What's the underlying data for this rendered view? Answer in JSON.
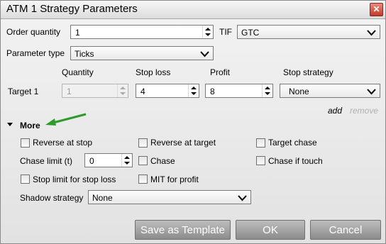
{
  "title": "ATM 1 Strategy Parameters",
  "close_label": "✕",
  "order_quantity": {
    "label": "Order quantity",
    "value": "1"
  },
  "tif": {
    "label": "TIF",
    "value": "GTC"
  },
  "parameter_type": {
    "label": "Parameter type",
    "value": "Ticks"
  },
  "columns": {
    "quantity": "Quantity",
    "stop_loss": "Stop loss",
    "profit": "Profit",
    "stop_strategy": "Stop strategy"
  },
  "target1": {
    "label": "Target 1",
    "quantity": "1",
    "stop_loss": "4",
    "profit": "8",
    "stop_strategy": "None"
  },
  "links": {
    "add": "add",
    "remove": "remove"
  },
  "more": {
    "label": "More"
  },
  "options": {
    "reverse_at_stop": "Reverse at stop",
    "reverse_at_target": "Reverse at target",
    "target_chase": "Target chase",
    "chase_limit_label": "Chase limit (t)",
    "chase_limit_value": "0",
    "chase": "Chase",
    "chase_if_touch": "Chase if touch",
    "stop_limit_for_stop_loss": "Stop limit for stop loss",
    "mit_for_profit": "MIT for profit"
  },
  "shadow_strategy": {
    "label": "Shadow strategy",
    "value": "None"
  },
  "buttons": {
    "save_template": "Save as Template",
    "ok": "OK",
    "cancel": "Cancel"
  },
  "colors": {
    "arrow": "#2e9a2a",
    "button": "#9e9e9e",
    "close": "#c94a3a"
  },
  "icons": {
    "close": "close-icon",
    "dropdown": "chevron-down-icon",
    "spinner": "spinner-arrows-icon",
    "expand": "triangle-down-icon"
  }
}
